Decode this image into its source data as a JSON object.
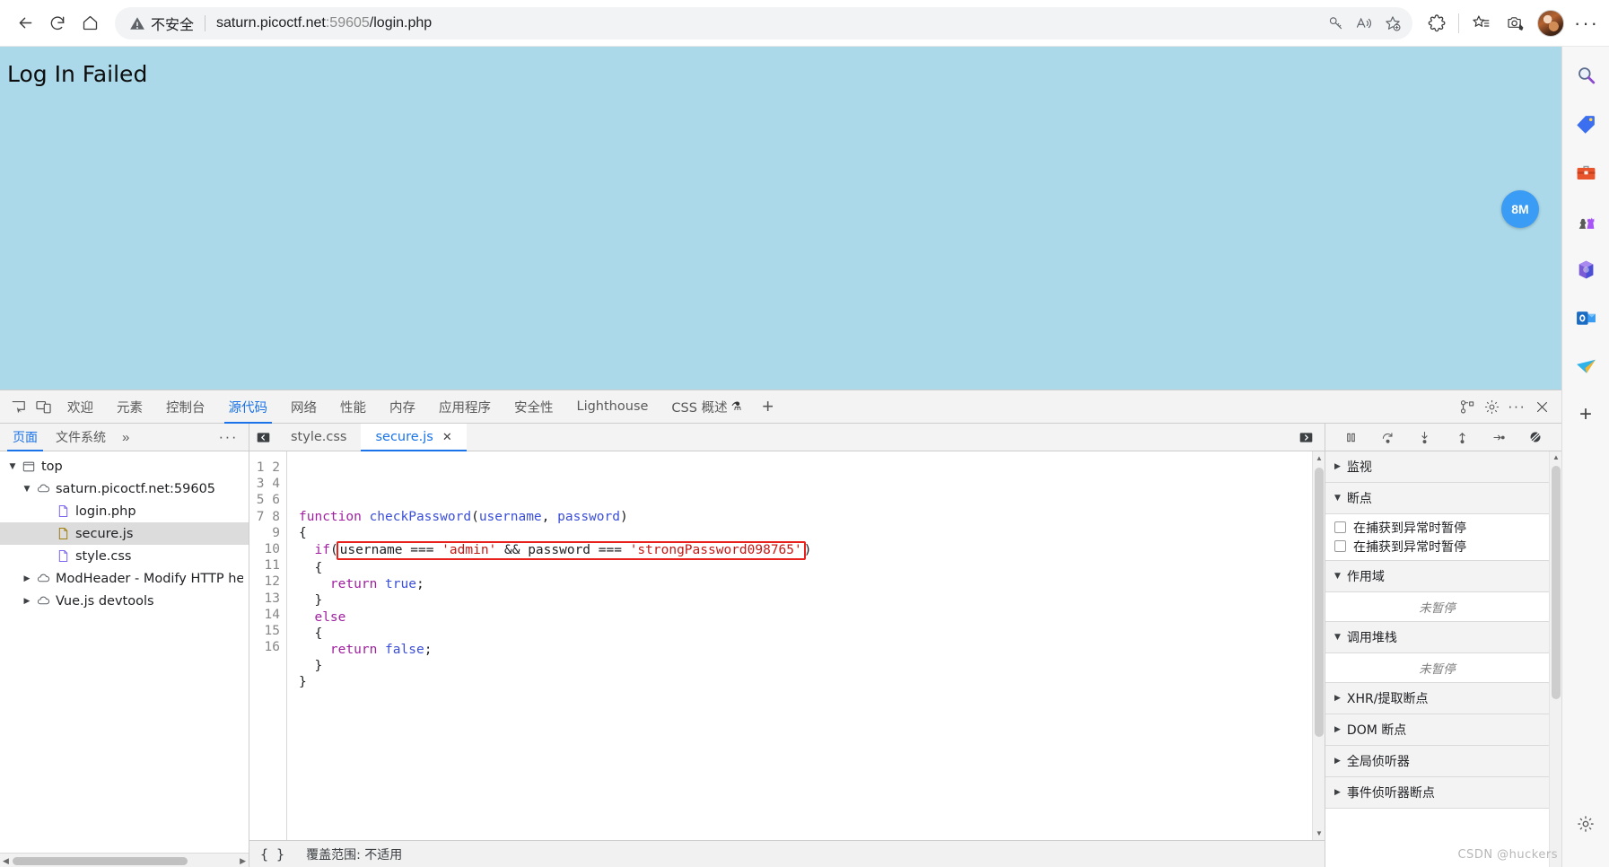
{
  "browser": {
    "nav": {
      "back": "back-arrow",
      "refresh": "refresh",
      "home": "home"
    },
    "omnibox": {
      "security_label": "不安全",
      "url_host": "saturn.picoctf.net",
      "url_port": ":59605",
      "url_path": "/login.php",
      "icons": [
        "key-icon",
        "read-aloud-icon",
        "add-favorite-icon"
      ]
    },
    "toolbar_icons": [
      "extensions-icon",
      "collections-icon",
      "screenshot-icon",
      "profile-avatar",
      "settings-more-icon"
    ]
  },
  "page": {
    "title": "Log In Failed",
    "badge": "8M",
    "background_color": "#abd9e9"
  },
  "devtools": {
    "tabs": [
      {
        "label": "欢迎",
        "active": false
      },
      {
        "label": "元素",
        "active": false
      },
      {
        "label": "控制台",
        "active": false
      },
      {
        "label": "源代码",
        "active": true
      },
      {
        "label": "网络",
        "active": false
      },
      {
        "label": "性能",
        "active": false
      },
      {
        "label": "内存",
        "active": false
      },
      {
        "label": "应用程序",
        "active": false
      },
      {
        "label": "安全性",
        "active": false
      },
      {
        "label": "Lighthouse",
        "active": false
      },
      {
        "label": "CSS 概述",
        "active": false,
        "beaker": true
      }
    ],
    "add_tab": "+",
    "right_icons": [
      "inspect-devices-icon",
      "settings-gear-icon",
      "more-options-icon",
      "close-icon"
    ],
    "navigator": {
      "tabs": [
        {
          "label": "页面",
          "active": true
        },
        {
          "label": "文件系统",
          "active": false
        }
      ],
      "more_chevron": "»",
      "more_options": "···",
      "tree": [
        {
          "label": "top",
          "indent": 0,
          "twisty": "▼",
          "icon": "frame-icon"
        },
        {
          "label": "saturn.picoctf.net:59605",
          "indent": 1,
          "twisty": "▼",
          "icon": "cloud-icon"
        },
        {
          "label": "login.php",
          "indent": 2,
          "twisty": "",
          "icon": "file-php-icon"
        },
        {
          "label": "secure.js",
          "indent": 2,
          "twisty": "",
          "icon": "file-js-icon",
          "selected": true
        },
        {
          "label": "style.css",
          "indent": 2,
          "twisty": "",
          "icon": "file-css-icon"
        },
        {
          "label": "ModHeader - Modify HTTP head",
          "indent": 1,
          "twisty": "▶",
          "icon": "cloud-icon"
        },
        {
          "label": "Vue.js devtools",
          "indent": 1,
          "twisty": "▶",
          "icon": "cloud-icon"
        }
      ]
    },
    "editor": {
      "tabs": [
        {
          "label": "style.css",
          "active": false,
          "closable": false
        },
        {
          "label": "secure.js",
          "active": true,
          "closable": true
        }
      ],
      "line_numbers": [
        1,
        2,
        3,
        4,
        5,
        6,
        7,
        8,
        9,
        10,
        11,
        12,
        13,
        14,
        15,
        16
      ],
      "code_lines": [
        "",
        "",
        "",
        "function checkPassword(username, password)",
        "{",
        "  if( username === 'admin' && password === 'strongPassword098765' )",
        "  {",
        "    return true;",
        "  }",
        "  else",
        "  {",
        "    return false;",
        "  }",
        "}",
        "",
        ""
      ],
      "highlight": {
        "line": 6,
        "text": "username === 'admin' && password === 'strongPassword098765'",
        "color": "#e8211c"
      },
      "credentials": {
        "username": "admin",
        "password": "strongPassword098765"
      },
      "status": {
        "pretty_print": "{ }",
        "coverage": "覆盖范围: 不适用"
      }
    },
    "debugger": {
      "toolbar_icons": [
        "pause-resume-icon",
        "step-over-icon",
        "step-into-icon",
        "step-out-icon",
        "step-icon",
        "deactivate-breakpoints-icon"
      ],
      "sections": [
        {
          "title": "监视",
          "expanded": false,
          "caret": "▶"
        },
        {
          "title": "断点",
          "expanded": true,
          "caret": "▼",
          "checkboxes": [
            {
              "label": "在捕获到异常时暂停",
              "checked": false
            },
            {
              "label": "在捕获到异常时暂停",
              "checked": false
            }
          ]
        },
        {
          "title": "作用域",
          "expanded": true,
          "caret": "▼",
          "empty_text": "未暂停"
        },
        {
          "title": "调用堆栈",
          "expanded": true,
          "caret": "▼",
          "empty_text": "未暂停"
        },
        {
          "title": "XHR/提取断点",
          "expanded": false,
          "caret": "▶"
        },
        {
          "title": "DOM 断点",
          "expanded": false,
          "caret": "▶"
        },
        {
          "title": "全局侦听器",
          "expanded": false,
          "caret": "▶"
        },
        {
          "title": "事件侦听器断点",
          "expanded": false,
          "caret": "▶"
        }
      ]
    }
  },
  "edge_sidebar": {
    "items": [
      "search-icon",
      "shopping-tag-icon",
      "tools-briefcase-icon",
      "games-chess-icon",
      "microsoft-365-icon",
      "outlook-icon",
      "send-plane-icon"
    ],
    "add_button": "+",
    "settings": "sidebar-settings-gear-icon"
  },
  "watermark": "CSDN @huckers"
}
